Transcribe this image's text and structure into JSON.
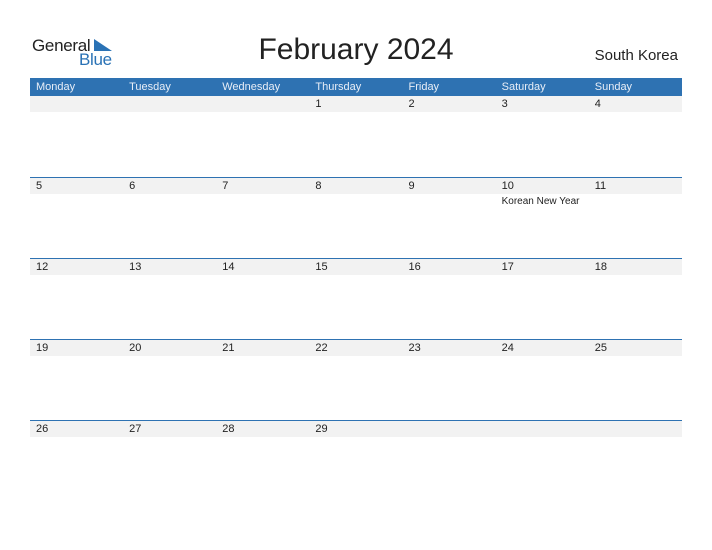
{
  "logo": {
    "line1": "General",
    "line2": "Blue"
  },
  "title": "February 2024",
  "country": "South Korea",
  "colors": {
    "accent": "#2e72b2",
    "date_strip": "#f2f2f2"
  },
  "weekdays": [
    "Monday",
    "Tuesday",
    "Wednesday",
    "Thursday",
    "Friday",
    "Saturday",
    "Sunday"
  ],
  "weeks": [
    {
      "days": [
        "",
        "",
        "",
        "1",
        "2",
        "3",
        "4"
      ],
      "events": [
        "",
        "",
        "",
        "",
        "",
        "",
        ""
      ]
    },
    {
      "days": [
        "5",
        "6",
        "7",
        "8",
        "9",
        "10",
        "11"
      ],
      "events": [
        "",
        "",
        "",
        "",
        "",
        "Korean New Year",
        ""
      ]
    },
    {
      "days": [
        "12",
        "13",
        "14",
        "15",
        "16",
        "17",
        "18"
      ],
      "events": [
        "",
        "",
        "",
        "",
        "",
        "",
        ""
      ]
    },
    {
      "days": [
        "19",
        "20",
        "21",
        "22",
        "23",
        "24",
        "25"
      ],
      "events": [
        "",
        "",
        "",
        "",
        "",
        "",
        ""
      ]
    },
    {
      "days": [
        "26",
        "27",
        "28",
        "29",
        "",
        "",
        ""
      ],
      "events": [
        "",
        "",
        "",
        "",
        "",
        "",
        ""
      ]
    }
  ]
}
